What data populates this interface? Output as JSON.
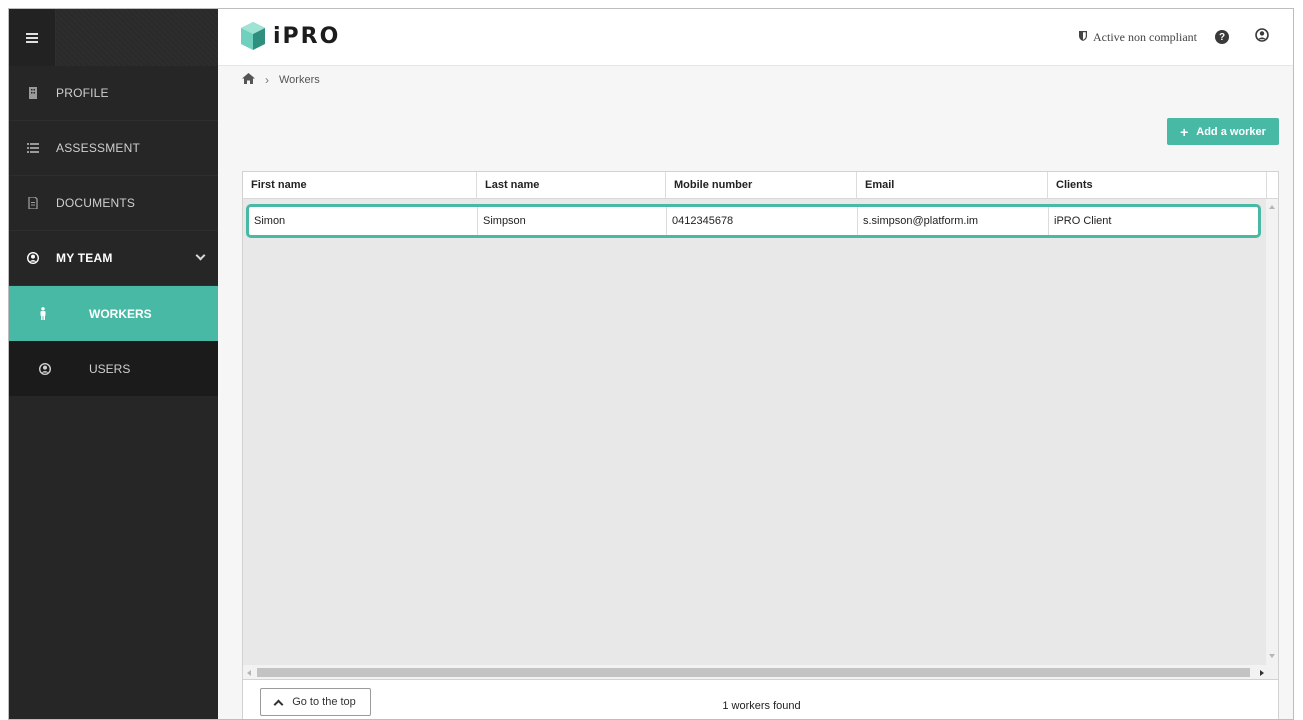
{
  "sidebar": {
    "items": [
      {
        "label": "PROFILE",
        "icon": "building-icon"
      },
      {
        "label": "ASSESSMENT",
        "icon": "list-icon"
      },
      {
        "label": "DOCUMENTS",
        "icon": "document-icon"
      },
      {
        "label": "MY TEAM",
        "icon": "user-circle-icon"
      }
    ],
    "subitems": [
      {
        "label": "WORKERS",
        "icon": "person-icon",
        "active": true
      },
      {
        "label": "USERS",
        "icon": "user-circle-icon",
        "active": false
      }
    ]
  },
  "header": {
    "logo_text": "iPRO",
    "status_label": "Active non compliant",
    "status_icon": "shield-icon",
    "help_icon": "help-icon",
    "user_icon": "account-icon"
  },
  "breadcrumb": {
    "home_icon": "home-icon",
    "current": "Workers"
  },
  "actions": {
    "add_label": "Add a worker"
  },
  "grid": {
    "columns": [
      "First name",
      "Last name",
      "Mobile number",
      "Email",
      "Clients"
    ],
    "rows": [
      [
        "Simon",
        "Simpson",
        "0412345678",
        "s.simpson@platform.im",
        "iPRO Client"
      ]
    ]
  },
  "footer": {
    "top_button": "Go to the top",
    "count_text": "1 workers found"
  },
  "colors": {
    "accent": "#47b9a5",
    "sidebar_bg": "#262626"
  }
}
